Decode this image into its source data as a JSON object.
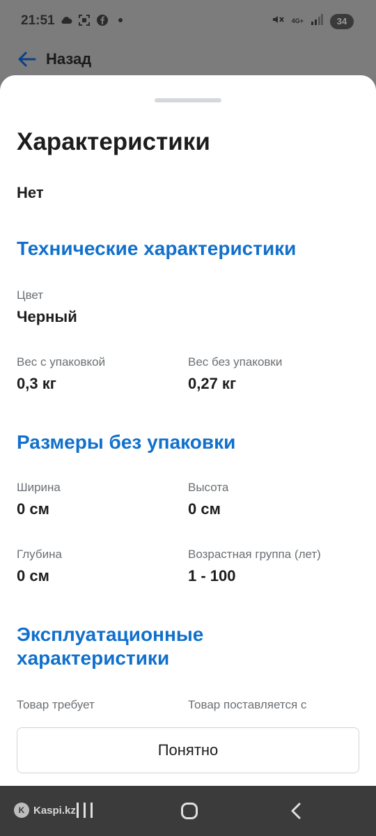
{
  "status_bar": {
    "time": "21:51",
    "network": "4G+",
    "battery": "34",
    "icons": [
      "cloud-icon",
      "screenshot-icon",
      "facebook-icon",
      "notification-dot",
      "mute-icon",
      "signal-icon"
    ]
  },
  "header": {
    "back_label": "Назад"
  },
  "sheet": {
    "title": "Характеристики",
    "partial_value": "Нет",
    "sections": {
      "technical": {
        "heading": "Технические характеристики",
        "color_label": "Цвет",
        "color_value": "Черный",
        "weight_packed_label": "Вес с упаковкой",
        "weight_packed_value": "0,3 кг",
        "weight_unpacked_label": "Вес без упаковки",
        "weight_unpacked_value": "0,27 кг"
      },
      "dimensions": {
        "heading": "Размеры без упаковки",
        "width_label": "Ширина",
        "width_value": "0 см",
        "height_label": "Высота",
        "height_value": "0 см",
        "depth_label": "Глубина",
        "depth_value": "0 см",
        "age_label": "Возрастная группа (лет)",
        "age_value": "1 - 100"
      },
      "operational": {
        "heading_line1": "Эксплуатационные",
        "heading_line2": "характеристики",
        "requires_label": "Товар требует",
        "supplied_label": "Товар поставляется с"
      }
    },
    "ok_button": "Понятно"
  },
  "navbar": {
    "watermark": "Kaspi.kz"
  },
  "colors": {
    "accent": "#1170cc",
    "overlay": "#7c7c7c",
    "navbar": "#3b3b3b"
  }
}
